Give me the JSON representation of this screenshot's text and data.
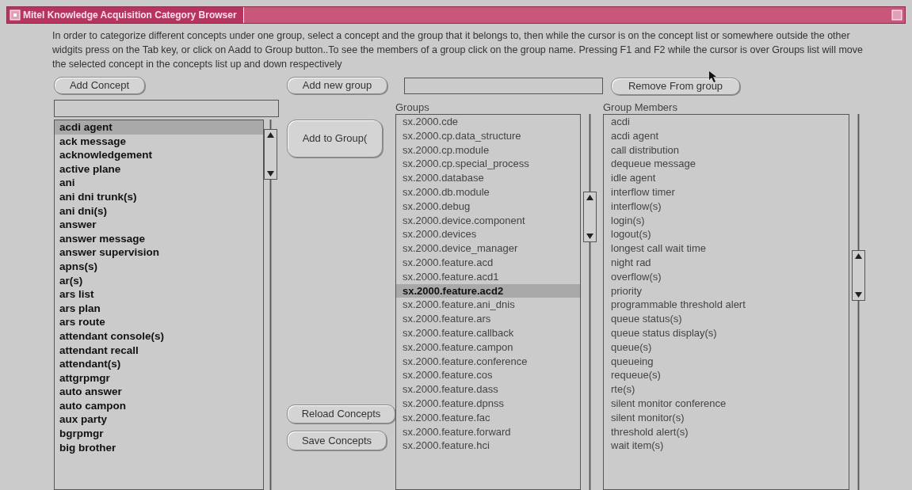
{
  "window": {
    "title": "Mitel Knowledge Acquisition Category Browser"
  },
  "instructions": "In order to categorize different concepts under one group, select a concept and the group that it belongs to, then while the cursor  is on the concept list or somewhere outside the other widgits press on the Tab key, or click on Aadd to Group button..To see the members of a group click on the group name. Pressing F1  and F2 while the cursor is over Groups list will move the selected concept in the concepts list up and down respectively",
  "buttons": {
    "add_concept": "Add Concept",
    "add_new_group": "Add new group",
    "remove_from_group": "Remove From group",
    "add_to_group": "Add to Group(",
    "reload_concepts": "Reload Concepts",
    "save_concepts": "Save Concepts"
  },
  "concepts": [
    {
      "label": "acdi agent",
      "selected": true
    },
    {
      "label": "ack message",
      "selected": false
    },
    {
      "label": "acknowledgement",
      "selected": false
    },
    {
      "label": "active plane",
      "selected": false
    },
    {
      "label": "ani",
      "selected": false
    },
    {
      "label": "ani dni trunk(s)",
      "selected": false
    },
    {
      "label": "ani dni(s)",
      "selected": false
    },
    {
      "label": "answer",
      "selected": false
    },
    {
      "label": "answer message",
      "selected": false
    },
    {
      "label": "answer supervision",
      "selected": false
    },
    {
      "label": "apns(s)",
      "selected": false
    },
    {
      "label": "ar(s)",
      "selected": false
    },
    {
      "label": "ars list",
      "selected": false
    },
    {
      "label": "ars plan",
      "selected": false
    },
    {
      "label": "ars route",
      "selected": false
    },
    {
      "label": "attendant console(s)",
      "selected": false
    },
    {
      "label": "attendant recall",
      "selected": false
    },
    {
      "label": "attendant(s)",
      "selected": false
    },
    {
      "label": "attgrpmgr",
      "selected": false
    },
    {
      "label": "auto answer",
      "selected": false
    },
    {
      "label": "auto campon",
      "selected": false
    },
    {
      "label": "aux party",
      "selected": false
    },
    {
      "label": "bgrpmgr",
      "selected": false
    },
    {
      "label": "big brother",
      "selected": false
    }
  ],
  "groups": {
    "label": "Groups",
    "items": [
      {
        "label": "sx.2000.cde",
        "selected": false
      },
      {
        "label": "sx.2000.cp.data_structure",
        "selected": false
      },
      {
        "label": "sx.2000.cp.module",
        "selected": false
      },
      {
        "label": "sx.2000.cp.special_process",
        "selected": false
      },
      {
        "label": "sx.2000.database",
        "selected": false
      },
      {
        "label": "sx.2000.db.module",
        "selected": false
      },
      {
        "label": "sx.2000.debug",
        "selected": false
      },
      {
        "label": "sx.2000.device.component",
        "selected": false
      },
      {
        "label": "sx.2000.devices",
        "selected": false
      },
      {
        "label": "sx.2000.device_manager",
        "selected": false
      },
      {
        "label": "sx.2000.feature.acd",
        "selected": false
      },
      {
        "label": "sx.2000.feature.acd1",
        "selected": false
      },
      {
        "label": "sx.2000.feature.acd2",
        "selected": true
      },
      {
        "label": "sx.2000.feature.ani_dnis",
        "selected": false
      },
      {
        "label": "sx.2000.feature.ars",
        "selected": false
      },
      {
        "label": "sx.2000.feature.callback",
        "selected": false
      },
      {
        "label": "sx.2000.feature.campon",
        "selected": false
      },
      {
        "label": "sx.2000.feature.conference",
        "selected": false
      },
      {
        "label": "sx.2000.feature.cos",
        "selected": false
      },
      {
        "label": "sx.2000.feature.dass",
        "selected": false
      },
      {
        "label": "sx.2000.feature.dpnss",
        "selected": false
      },
      {
        "label": "sx.2000.feature.fac",
        "selected": false
      },
      {
        "label": "sx.2000.feature.forward",
        "selected": false
      },
      {
        "label": "sx.2000.feature.hci",
        "selected": false
      }
    ]
  },
  "members": {
    "label": "Group Members",
    "items": [
      "acdi",
      "acdi agent",
      "call distribution",
      "dequeue message",
      "idle agent",
      "interflow timer",
      "interflow(s)",
      "login(s)",
      "logout(s)",
      "longest call wait time",
      "night rad",
      "overflow(s)",
      "priority",
      "programmable threshold alert",
      "queue status(s)",
      "queue status display(s)",
      "queue(s)",
      "queueing",
      "requeue(s)",
      "rte(s)",
      "silent monitor conference",
      "silent monitor(s)",
      "threshold alert(s)",
      "wait item(s)"
    ]
  }
}
